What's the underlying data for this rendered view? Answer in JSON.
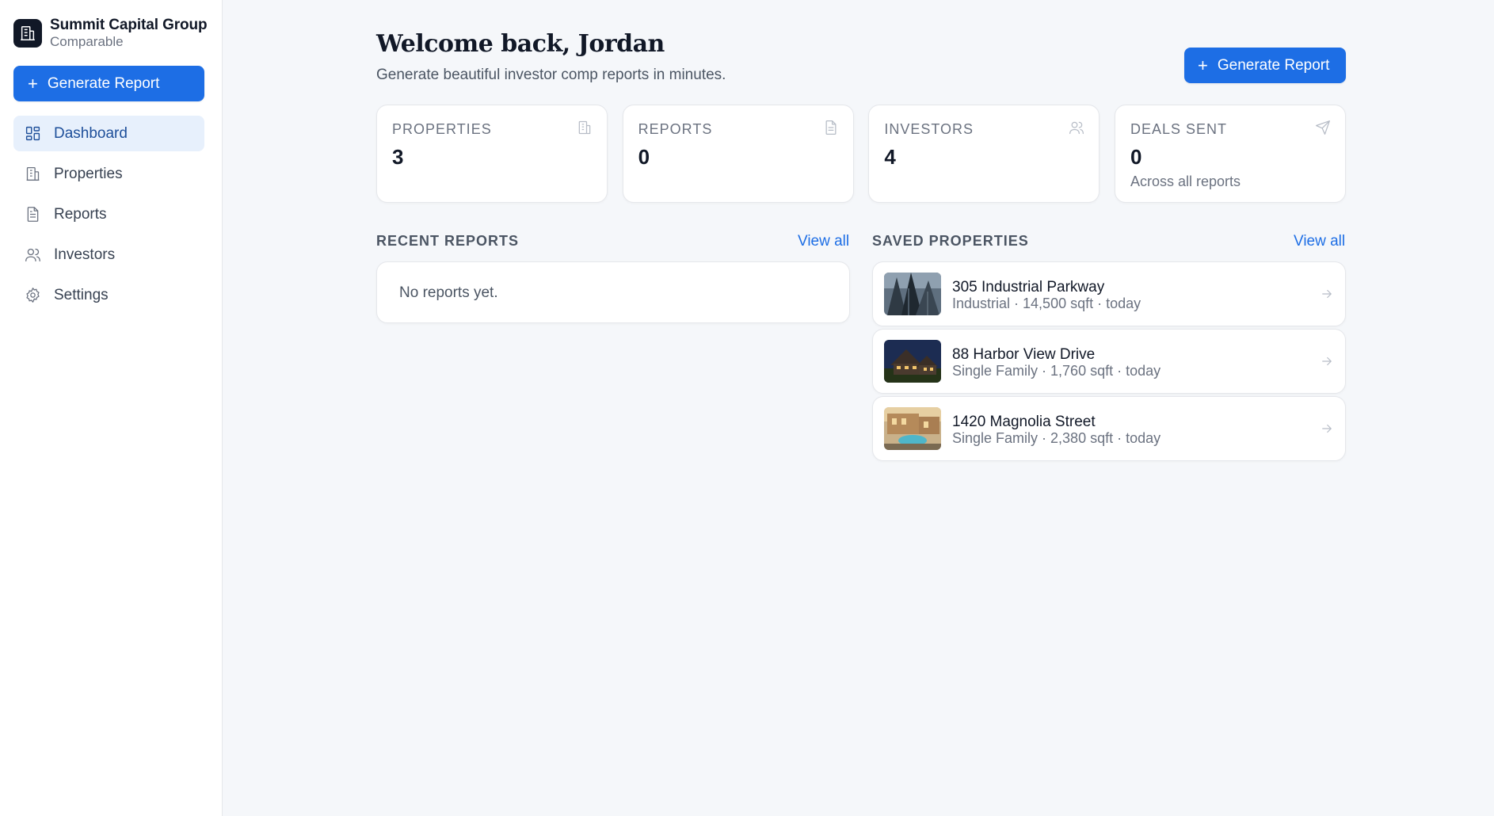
{
  "brand": {
    "name": "Summit Capital Group",
    "sub": "Comparable"
  },
  "sidebar": {
    "generate_label": "Generate Report",
    "items": [
      {
        "label": "Dashboard",
        "icon": "dashboard-grid-icon",
        "active": true
      },
      {
        "label": "Properties",
        "icon": "building-icon"
      },
      {
        "label": "Reports",
        "icon": "document-icon"
      },
      {
        "label": "Investors",
        "icon": "users-icon"
      },
      {
        "label": "Settings",
        "icon": "gear-icon"
      }
    ]
  },
  "header": {
    "title": "Welcome back, Jordan",
    "subtitle": "Generate beautiful investor comp reports in minutes.",
    "generate_label": "Generate Report"
  },
  "stats": [
    {
      "label": "PROPERTIES",
      "value": "3",
      "icon": "building-icon"
    },
    {
      "label": "REPORTS",
      "value": "0",
      "icon": "document-icon"
    },
    {
      "label": "INVESTORS",
      "value": "4",
      "icon": "users-icon"
    },
    {
      "label": "DEALS SENT",
      "value": "0",
      "note": "Across all reports",
      "icon": "send-icon"
    }
  ],
  "recent_reports": {
    "heading": "RECENT REPORTS",
    "view_all": "View all",
    "empty": "No reports yet."
  },
  "saved_properties": {
    "heading": "SAVED PROPERTIES",
    "view_all": "View all",
    "items": [
      {
        "name": "305 Industrial Parkway",
        "meta": "Industrial · 14,500 sqft · today"
      },
      {
        "name": "88 Harbor View Drive",
        "meta": "Single Family · 1,760 sqft · today"
      },
      {
        "name": "1420 Magnolia Street",
        "meta": "Single Family · 2,380 sqft · today"
      }
    ]
  },
  "colors": {
    "accent": "#1d6ee5",
    "active_nav_bg": "#e7f0fc",
    "background": "#f5f7fa"
  }
}
